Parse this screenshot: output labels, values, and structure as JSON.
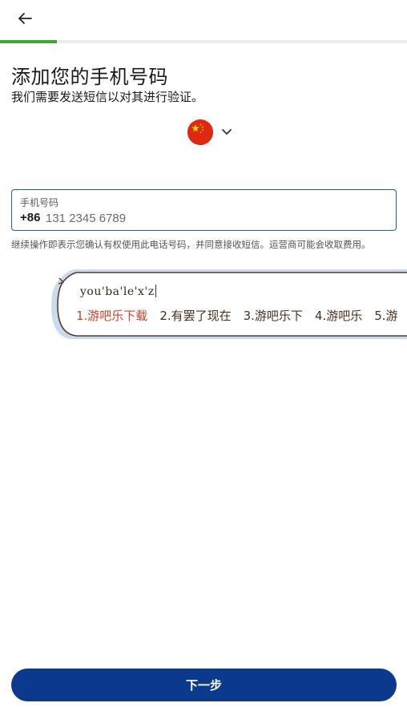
{
  "progress": {
    "fraction": 0.14,
    "color": "#3fa535"
  },
  "header": {
    "title": "添加您的手机号码",
    "subtitle": "我们需要发送短信以对其进行验证。"
  },
  "country": {
    "flag_icon": "china-flag-icon",
    "dropdown_icon": "chevron-down-icon"
  },
  "phone": {
    "label": "手机号码",
    "prefix": "+86",
    "placeholder": "131 2345 6789"
  },
  "disclaimer": "继续操作即表示您确认有权使用此电话号码，并同意接收短信。运营商可能会收取费用。",
  "ime": {
    "composition": "you'ba'le'x'z",
    "candidates": [
      "1.游吧乐下载",
      "2.有罢了现在",
      "3.游吧乐下",
      "4.游吧乐",
      "5.游"
    ]
  },
  "footer": {
    "next_label": "下一步",
    "button_color": "#0b3a8c"
  },
  "colors": {
    "accent": "#1f5fa8",
    "ime_active": "#d6402a"
  }
}
